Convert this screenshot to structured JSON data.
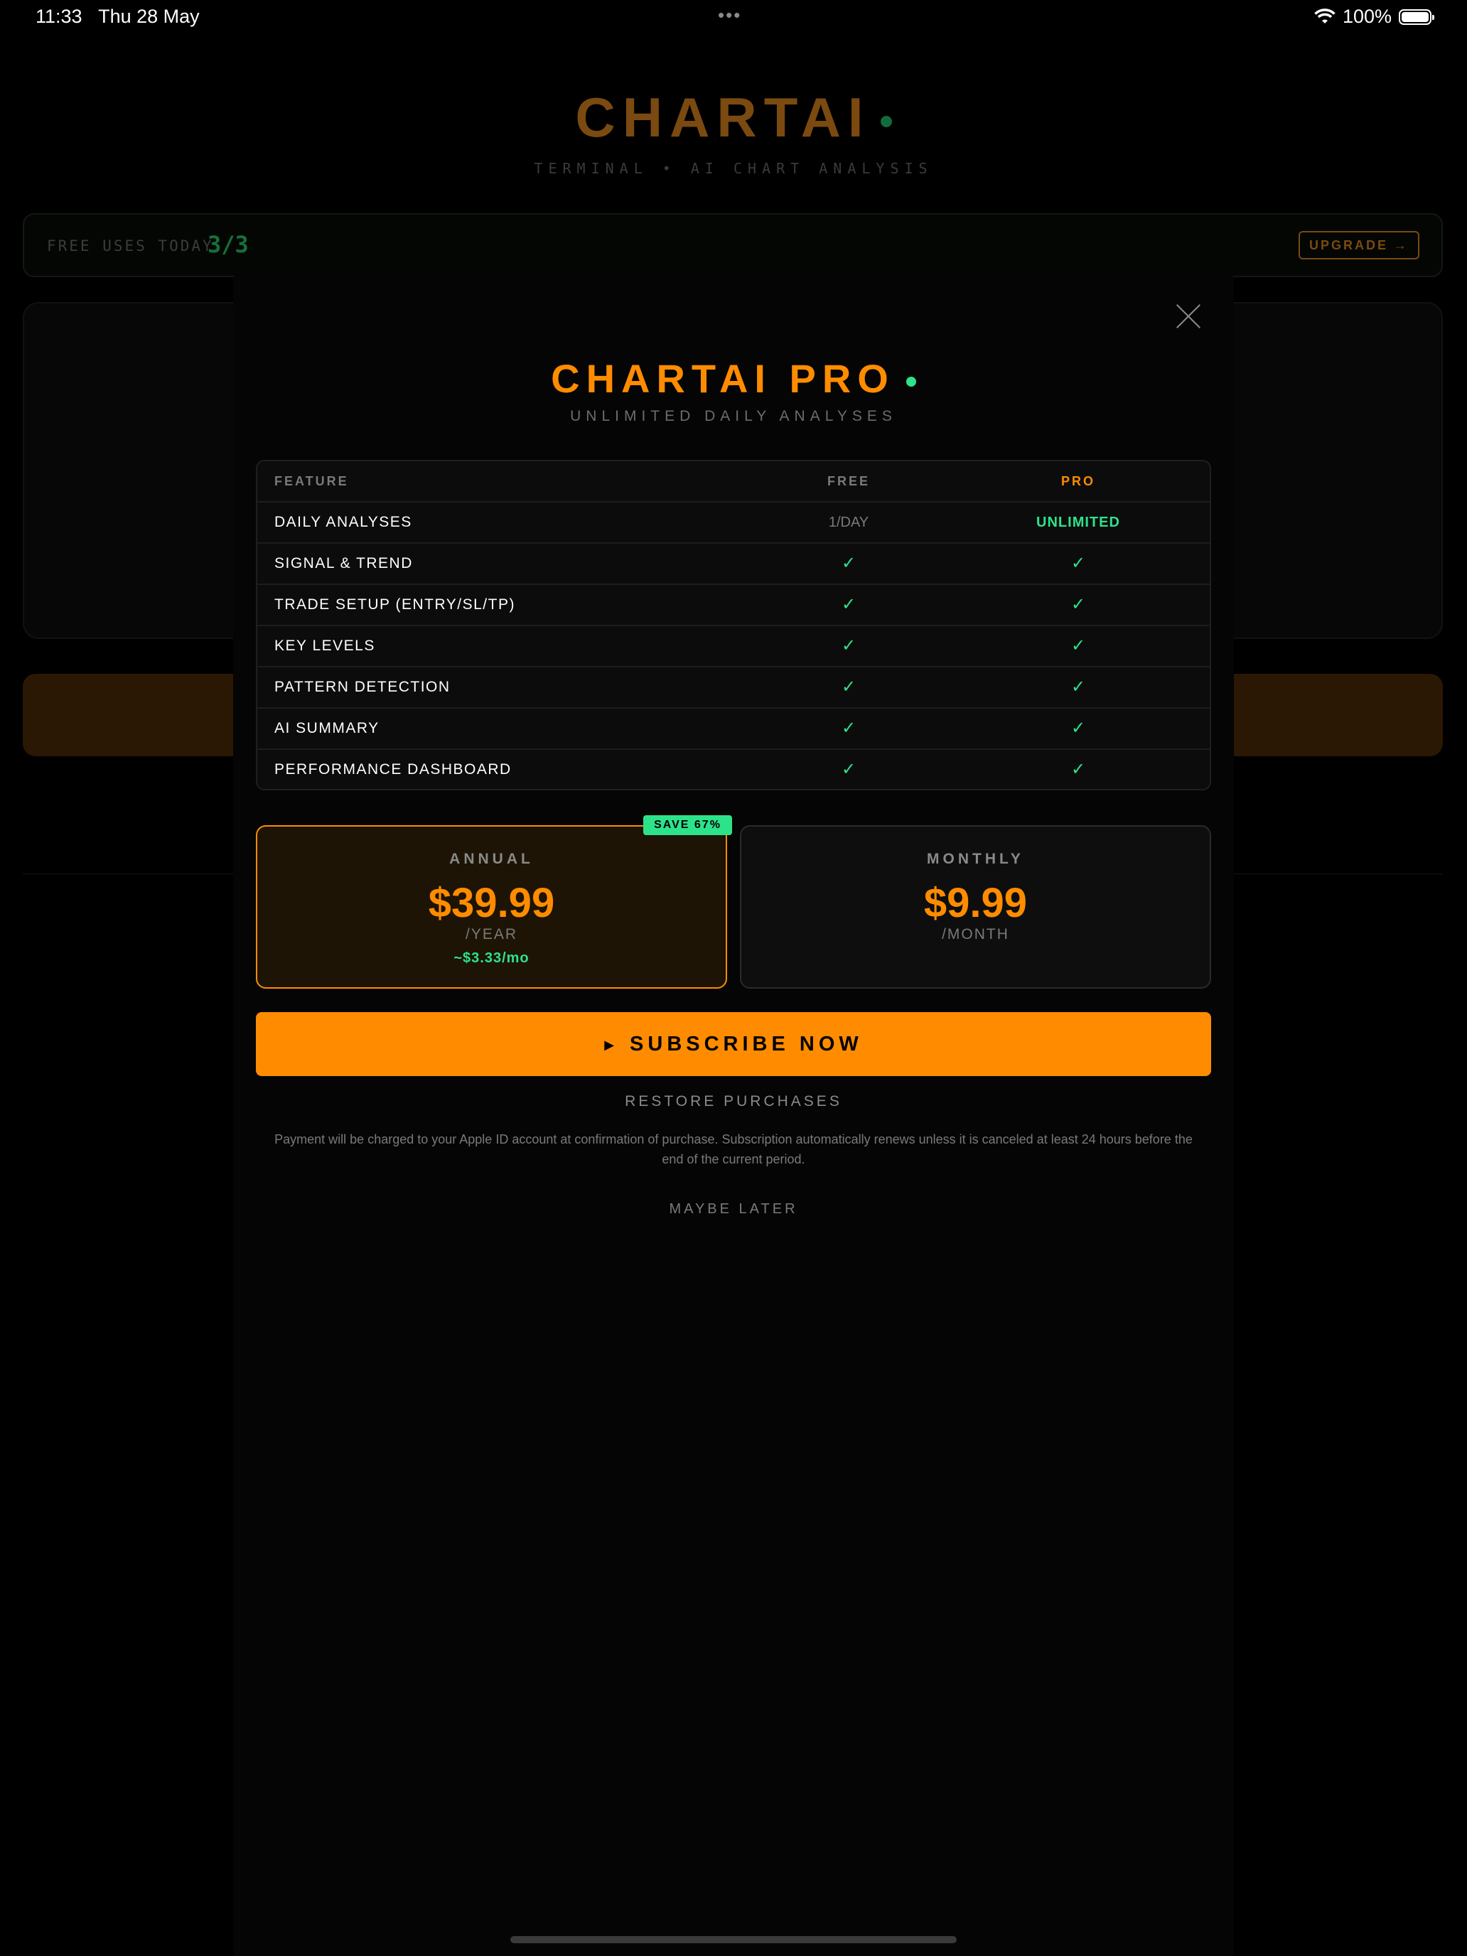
{
  "status_bar": {
    "time": "11:33",
    "date": "Thu 28 May",
    "dots": "•••",
    "battery": "100%"
  },
  "background_app": {
    "logo": "CHARTAI",
    "subtitle": "TERMINAL • AI CHART ANALYSIS",
    "usage_label": "FREE USES TODAY",
    "usage_count": "3/3",
    "upgrade_label": "UPGRADE →"
  },
  "modal": {
    "title": "CHARTAI PRO",
    "subtitle": "UNLIMITED DAILY ANALYSES",
    "table": {
      "headers": {
        "feature": "FEATURE",
        "free": "FREE",
        "pro": "PRO"
      },
      "rows": [
        {
          "name": "DAILY ANALYSES",
          "free": "1/DAY",
          "pro": "UNLIMITED"
        },
        {
          "name": "SIGNAL & TREND",
          "free": "✓",
          "pro": "✓"
        },
        {
          "name": "TRADE SETUP (ENTRY/SL/TP)",
          "free": "✓",
          "pro": "✓"
        },
        {
          "name": "KEY LEVELS",
          "free": "✓",
          "pro": "✓"
        },
        {
          "name": "PATTERN DETECTION",
          "free": "✓",
          "pro": "✓"
        },
        {
          "name": "AI SUMMARY",
          "free": "✓",
          "pro": "✓"
        },
        {
          "name": "PERFORMANCE DASHBOARD",
          "free": "✓",
          "pro": "✓"
        }
      ]
    },
    "plans": {
      "annual": {
        "name": "ANNUAL",
        "price": "$39.99",
        "period": "/YEAR",
        "per_month": "~$3.33/mo",
        "badge": "SAVE 67%"
      },
      "monthly": {
        "name": "MONTHLY",
        "price": "$9.99",
        "period": "/MONTH"
      }
    },
    "subscribe_label": "SUBSCRIBE NOW",
    "subscribe_arrow": "▶",
    "restore_label": "RESTORE PURCHASES",
    "legal": "Payment will be charged to your Apple ID account at confirmation of purchase. Subscription automatically renews unless it is canceled at least 24 hours before the end of the current period.",
    "later_label": "MAYBE LATER"
  },
  "colors": {
    "accent": "#ff8c00",
    "success": "#2de38a",
    "background": "#000000"
  }
}
